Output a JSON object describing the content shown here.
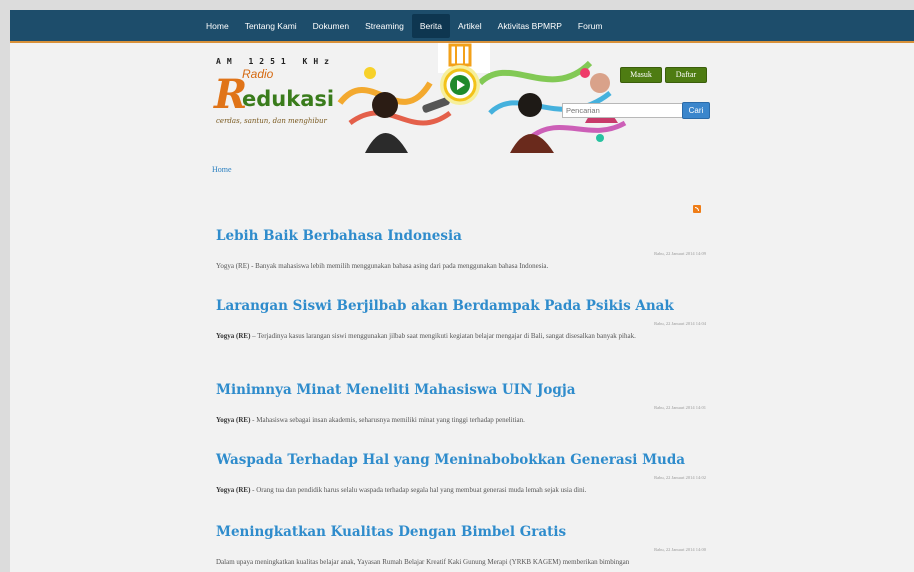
{
  "nav": {
    "items": [
      {
        "label": "Home"
      },
      {
        "label": "Tentang Kami"
      },
      {
        "label": "Dokumen"
      },
      {
        "label": "Streaming"
      },
      {
        "label": "Berita"
      },
      {
        "label": "Artikel"
      },
      {
        "label": "Aktivitas BPMRP"
      },
      {
        "label": "Forum"
      }
    ],
    "active_index": 4
  },
  "logo": {
    "frequency": "AM 1251 KHz",
    "radio": "Radio",
    "r_letter": "R",
    "edukasi": "edukasi",
    "tagline": "cerdas, santun, dan menghibur"
  },
  "auth": {
    "login_label": "Masuk",
    "register_label": "Daftar"
  },
  "search": {
    "placeholder": "Pencarian",
    "button_label": "Cari"
  },
  "breadcrumb": {
    "home": "Home"
  },
  "colors": {
    "nav_bg": "#1d4d6b",
    "accent": "#d8913a",
    "link": "#2f8ccc",
    "button_green": "#4e7c12"
  },
  "articles": [
    {
      "title": "Lebih Baik Berbahasa Indonesia",
      "date": "Rabu, 22 Januari 2014 14:09",
      "lead": "",
      "body": "Yogya (RE) - Banyak mahasiswa lebih memilih menggunakan bahasa asing dari pada menggunakan bahasa Indonesia."
    },
    {
      "title": "Larangan Siswi Berjilbab akan Berdampak Pada Psikis Anak",
      "date": "Rabu, 22 Januari 2014 14:04",
      "lead": "Yogya (RE)",
      "body": " – Terjadinya kasus larangan siswi menggunakan jilbab saat mengikuti kegiatan belajar mengajar di Bali, sangat disesalkan banyak pihak."
    },
    {
      "title": "Minimnya Minat Meneliti Mahasiswa UIN Jogja",
      "date": "Rabu, 22 Januari 2014 14:01",
      "lead": "Yogya (RE)",
      "body": " - Mahasiswa sebagai insan akademis, seharusnya memiliki minat yang tinggi terhadap penelitian."
    },
    {
      "title": "Waspada Terhadap Hal yang Meninabobokkan Generasi Muda",
      "date": "Rabu, 22 Januari 2014 14:02",
      "lead": "Yogya (RE)",
      "body": " - Orang tua dan pendidik harus selalu waspada terhadap segala hal yang membuat generasi muda lemah sejak usia dini."
    },
    {
      "title": "Meningkatkan Kualitas Dengan Bimbel Gratis",
      "date": "Rabu, 22 Januari 2014 14:00",
      "lead": "",
      "body": "Dalam upaya meningkatkan kualitas belajar anak, Yayasan Rumah Belajar Kreatif Kaki Gunung Merapi (YRKB KAGEM) memberikan bimbingan"
    }
  ]
}
